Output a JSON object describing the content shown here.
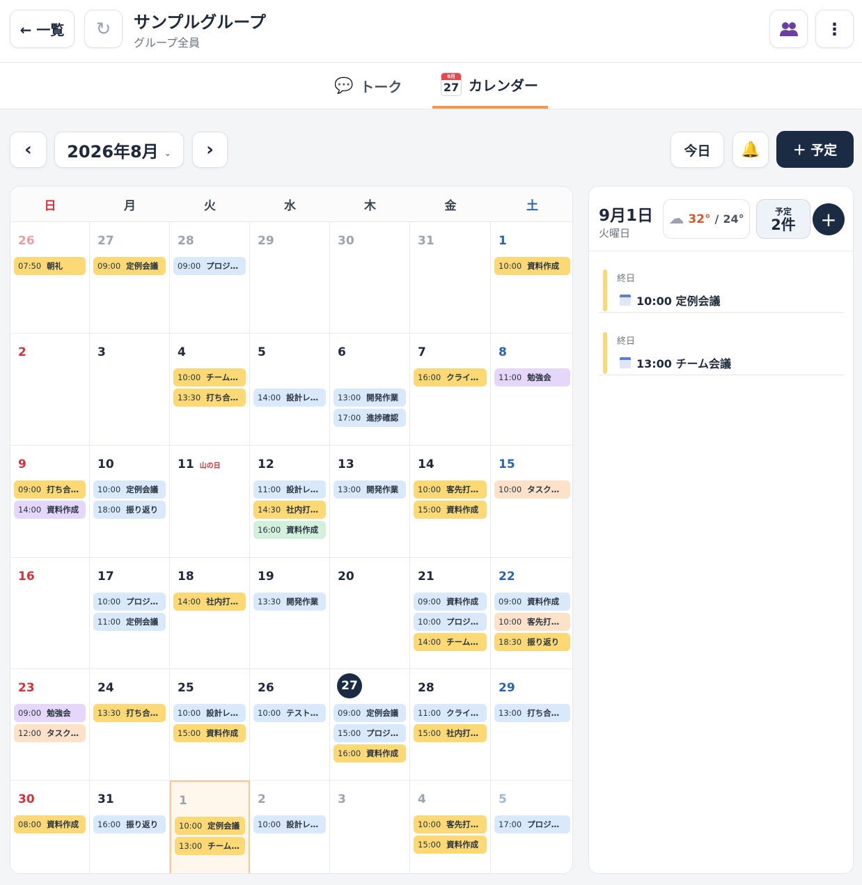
{
  "header": {
    "back_label": "← 一覧",
    "refresh_icon": "↻",
    "title": "サンプルグループ",
    "subtitle": "グループ全員",
    "more_icon": "⋮"
  },
  "tabs": {
    "talk_label": "トーク",
    "calendar_label": "カレンダー",
    "calendar_icon_month": "8月",
    "calendar_icon_day": "27"
  },
  "toolbar": {
    "prev": "‹",
    "month_label": "2026年8月",
    "month_chevron": "⌄",
    "next": "›",
    "today_label": "今日",
    "bell_icon": "🔔",
    "add_label": "＋ 予定"
  },
  "weekdays": [
    "日",
    "月",
    "火",
    "水",
    "木",
    "金",
    "土"
  ],
  "weeks": [
    [
      {
        "day": "26",
        "other": true,
        "events": [
          {
            "time": "07:50",
            "name": "朝礼",
            "color": "yellow"
          }
        ]
      },
      {
        "day": "27",
        "other": true,
        "events": [
          {
            "time": "09:00",
            "name": "定例会議",
            "color": "yellow"
          }
        ]
      },
      {
        "day": "28",
        "other": true,
        "events": [
          {
            "time": "09:00",
            "name": "プロジェクト…",
            "color": "blue"
          }
        ]
      },
      {
        "day": "29",
        "other": true,
        "events": []
      },
      {
        "day": "30",
        "other": true,
        "events": []
      },
      {
        "day": "31",
        "other": true,
        "events": []
      },
      {
        "day": "1",
        "events": [
          {
            "time": "10:00",
            "name": "資料作成",
            "color": "yellow"
          }
        ]
      }
    ],
    [
      {
        "day": "2",
        "events": []
      },
      {
        "day": "3",
        "events": []
      },
      {
        "day": "4",
        "events": [
          {
            "time": "10:00",
            "name": "チーム会議",
            "color": "yellow"
          },
          {
            "time": "13:30",
            "name": "打ち合わせ",
            "color": "yellow"
          }
        ]
      },
      {
        "day": "5",
        "events": [
          {
            "time": "14:00",
            "name": "設計レビュ…",
            "color": "blue",
            "offset": true
          }
        ]
      },
      {
        "day": "6",
        "events": [
          {
            "time": "13:00",
            "name": "開発作業",
            "color": "blue",
            "offset": true
          },
          {
            "time": "17:00",
            "name": "進捗確認",
            "color": "blue"
          }
        ]
      },
      {
        "day": "7",
        "events": [
          {
            "time": "16:00",
            "name": "クライアント…",
            "color": "yellow"
          }
        ]
      },
      {
        "day": "8",
        "events": [
          {
            "time": "11:00",
            "name": "勉強会",
            "color": "purple"
          }
        ]
      }
    ],
    [
      {
        "day": "9",
        "events": [
          {
            "time": "09:00",
            "name": "打ち合わせ",
            "color": "yellow"
          },
          {
            "time": "14:00",
            "name": "資料作成",
            "color": "purple"
          }
        ]
      },
      {
        "day": "10",
        "events": [
          {
            "time": "10:00",
            "name": "定例会議",
            "color": "blue"
          },
          {
            "time": "18:00",
            "name": "振り返り",
            "color": "blue"
          }
        ]
      },
      {
        "day": "11",
        "holiday": "山の日",
        "events": []
      },
      {
        "day": "12",
        "events": [
          {
            "time": "11:00",
            "name": "設計レビュ…",
            "color": "blue"
          },
          {
            "time": "14:30",
            "name": "社内打ち合わせ",
            "color": "yellow"
          },
          {
            "time": "16:00",
            "name": "資料作成",
            "color": "green"
          }
        ]
      },
      {
        "day": "13",
        "events": [
          {
            "time": "13:00",
            "name": "開発作業",
            "color": "blue"
          }
        ]
      },
      {
        "day": "14",
        "events": [
          {
            "time": "10:00",
            "name": "客先打ち合わせ",
            "color": "yellow"
          },
          {
            "time": "15:00",
            "name": "資料作成",
            "color": "yellow"
          }
        ]
      },
      {
        "day": "15",
        "events": [
          {
            "time": "10:00",
            "name": "タスク整理",
            "color": "orange"
          }
        ]
      }
    ],
    [
      {
        "day": "16",
        "events": []
      },
      {
        "day": "17",
        "events": [
          {
            "time": "10:00",
            "name": "プロジェクト…",
            "color": "blue"
          },
          {
            "time": "11:00",
            "name": "定例会議",
            "color": "blue"
          }
        ]
      },
      {
        "day": "18",
        "events": [
          {
            "time": "14:00",
            "name": "社内打ち合わせ",
            "color": "yellow"
          }
        ]
      },
      {
        "day": "19",
        "events": [
          {
            "time": "13:30",
            "name": "開発作業",
            "color": "blue"
          }
        ]
      },
      {
        "day": "20",
        "events": []
      },
      {
        "day": "21",
        "events": [
          {
            "time": "09:00",
            "name": "資料作成",
            "color": "blue"
          },
          {
            "time": "10:00",
            "name": "プロジェクト…",
            "color": "blue"
          },
          {
            "time": "14:00",
            "name": "チーム会議",
            "color": "yellow"
          }
        ]
      },
      {
        "day": "22",
        "events": [
          {
            "time": "09:00",
            "name": "資料作成",
            "color": "blue"
          },
          {
            "time": "10:00",
            "name": "客先打ち合わせ",
            "color": "orange"
          },
          {
            "time": "18:30",
            "name": "振り返り",
            "color": "yellow"
          }
        ]
      }
    ],
    [
      {
        "day": "23",
        "events": [
          {
            "time": "09:00",
            "name": "勉強会",
            "color": "purple"
          },
          {
            "time": "12:00",
            "name": "タスク整理",
            "color": "orange"
          }
        ]
      },
      {
        "day": "24",
        "events": [
          {
            "time": "13:30",
            "name": "打ち合わせ",
            "color": "yellow"
          }
        ]
      },
      {
        "day": "25",
        "events": [
          {
            "time": "10:00",
            "name": "設計レビュ…",
            "color": "blue"
          },
          {
            "time": "15:00",
            "name": "資料作成",
            "color": "yellow"
          }
        ]
      },
      {
        "day": "26",
        "events": [
          {
            "time": "10:00",
            "name": "テスト作業",
            "color": "blue"
          }
        ]
      },
      {
        "day": "27",
        "today": true,
        "events": [
          {
            "time": "09:00",
            "name": "定例会議",
            "color": "blue"
          },
          {
            "time": "15:00",
            "name": "プロジェクト…",
            "color": "blue"
          },
          {
            "time": "16:00",
            "name": "資料作成",
            "color": "yellow"
          }
        ]
      },
      {
        "day": "28",
        "events": [
          {
            "time": "11:00",
            "name": "クライアント…",
            "color": "blue"
          },
          {
            "time": "15:00",
            "name": "社内打ち合わせ",
            "color": "yellow"
          }
        ]
      },
      {
        "day": "29",
        "events": [
          {
            "time": "13:00",
            "name": "打ち合わせ",
            "color": "blue"
          }
        ]
      }
    ],
    [
      {
        "day": "30",
        "events": [
          {
            "time": "08:00",
            "name": "資料作成",
            "color": "yellow"
          }
        ]
      },
      {
        "day": "31",
        "events": [
          {
            "time": "16:00",
            "name": "振り返り",
            "color": "blue"
          }
        ]
      },
      {
        "day": "1",
        "other": true,
        "selected": true,
        "events": [
          {
            "time": "10:00",
            "name": "定例会議",
            "color": "yellow"
          },
          {
            "time": "13:00",
            "name": "チーム会議",
            "color": "yellow"
          }
        ]
      },
      {
        "day": "2",
        "other": true,
        "events": [
          {
            "time": "10:00",
            "name": "設計レビュ…",
            "color": "blue"
          }
        ]
      },
      {
        "day": "3",
        "other": true,
        "events": []
      },
      {
        "day": "4",
        "other": true,
        "events": [
          {
            "time": "10:00",
            "name": "客先打ち合わせ",
            "color": "yellow"
          },
          {
            "time": "15:00",
            "name": "資料作成",
            "color": "yellow"
          }
        ]
      },
      {
        "day": "5",
        "other": true,
        "events": [
          {
            "time": "17:00",
            "name": "プロジェクト…",
            "color": "blue"
          }
        ]
      }
    ]
  ],
  "side": {
    "date": "9月1日",
    "dow": "火曜日",
    "weather_icon": "☁",
    "temp_high": "32°",
    "temp_sep": "/",
    "temp_low": "24°",
    "count_label": "予定",
    "count_value": "2件",
    "add_icon": "+",
    "items": [
      {
        "label": "終日",
        "title": "10:00 定例会議"
      },
      {
        "label": "終日",
        "title": "13:00 チーム会議"
      }
    ]
  }
}
